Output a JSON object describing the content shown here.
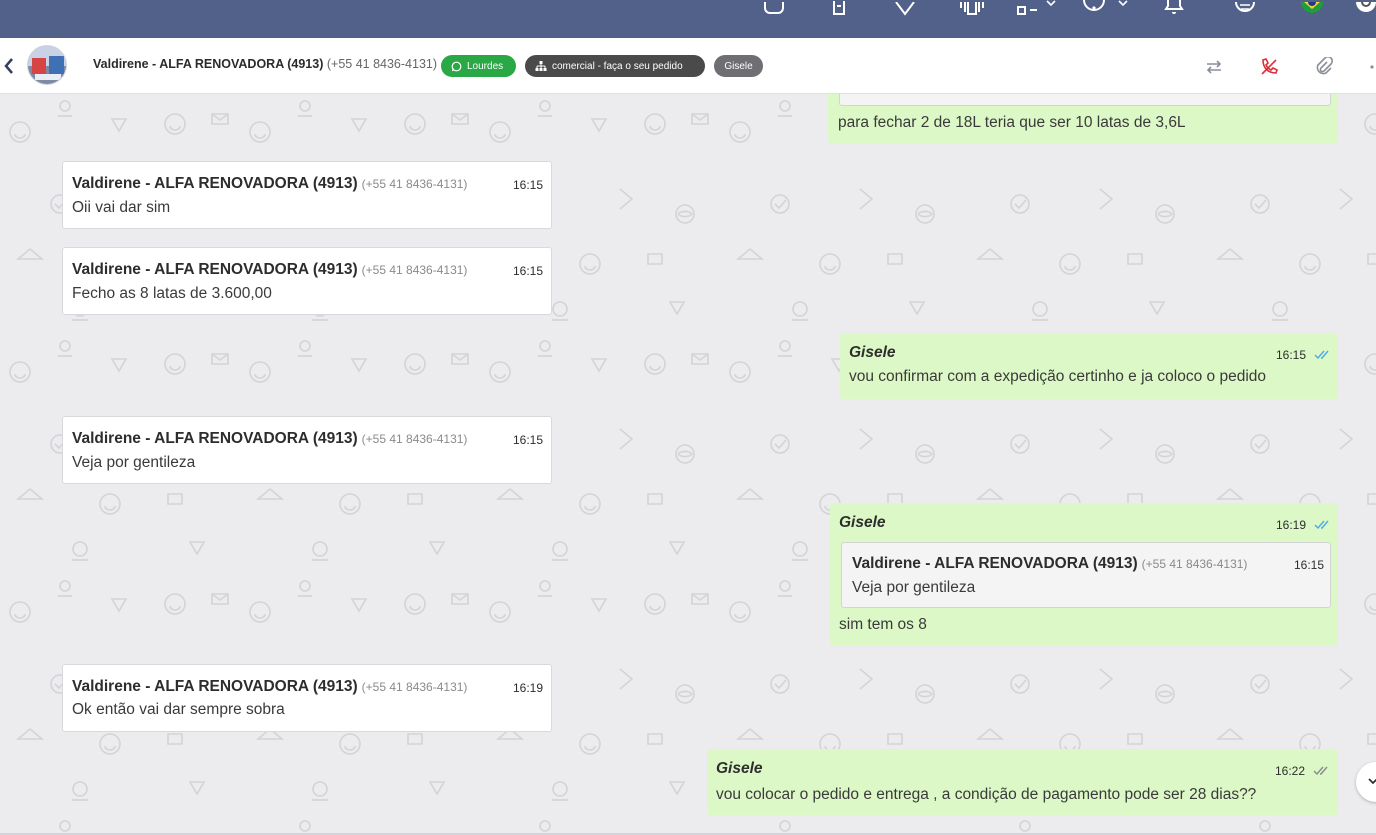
{
  "header": {
    "contact_name": "Valdirene - ALFA RENOVADORA (4913)",
    "contact_phone": "(+55 41 8436-4131)",
    "tags": {
      "channel": "Lourdes",
      "queue": "comercial - faça o seu pedido",
      "agent": "Gisele"
    }
  },
  "messages": {
    "m0": {
      "text": "para fechar 2 de 18L teria que ser 10 latas de 3,6L"
    },
    "m1": {
      "sender": "Valdirene - ALFA RENOVADORA (4913)",
      "phone": "(+55 41 8436-4131)",
      "time": "16:15",
      "text": "Oii vai dar sim"
    },
    "m2": {
      "sender": "Valdirene - ALFA RENOVADORA (4913)",
      "phone": "(+55 41 8436-4131)",
      "time": "16:15",
      "text": "Fecho as 8 latas de 3.600,00"
    },
    "m3": {
      "sender": "Gisele",
      "time": "16:15",
      "text": "vou confirmar com a expedição certinho e ja coloco o pedido",
      "status": "read"
    },
    "m4": {
      "sender": "Valdirene - ALFA RENOVADORA (4913)",
      "phone": "(+55 41 8436-4131)",
      "time": "16:15",
      "text": "Veja por gentileza"
    },
    "m5": {
      "sender": "Gisele",
      "time": "16:19",
      "text": "sim tem os 8",
      "status": "read",
      "quote": {
        "sender": "Valdirene - ALFA RENOVADORA (4913)",
        "phone": "(+55 41 8436-4131)",
        "time": "16:15",
        "text": "Veja por gentileza"
      }
    },
    "m6": {
      "sender": "Valdirene - ALFA RENOVADORA (4913)",
      "phone": "(+55 41 8436-4131)",
      "time": "16:19",
      "text": "Ok então vai dar sempre sobra"
    },
    "m7": {
      "sender": "Gisele",
      "time": "16:22",
      "text": "vou colocar o pedido e entrega , a condição de pagamento pode ser 28 dias??",
      "status": "delivered"
    }
  },
  "colors": {
    "topbar": "#52618a",
    "outgoing_bubble": "#dcf8c6",
    "incoming_bubble": "#ffffff",
    "tag_green": "#2aa845",
    "tag_dark": "#4a4a4a",
    "tag_gray": "#6e6e73",
    "read_ticks": "#4fa9e8",
    "delivered_ticks": "#8a8a8a",
    "call_icon": "#d9303a"
  }
}
